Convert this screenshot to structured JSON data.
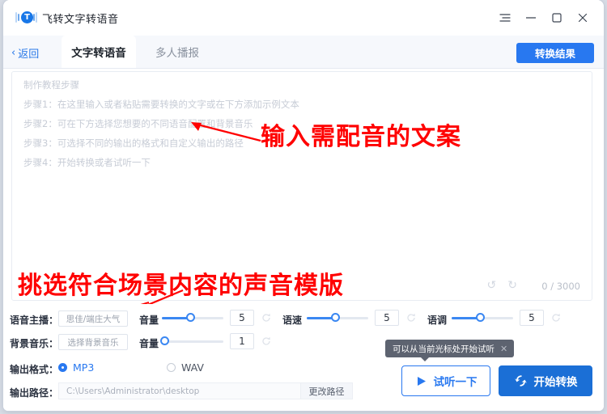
{
  "window": {
    "app_title": "飞转文字转语音",
    "logo_letter": "T",
    "controls": {
      "menu": "menu-icon",
      "minimize": "minimize-icon",
      "maximize": "maximize-icon",
      "close": "close-icon"
    }
  },
  "tabbar": {
    "back_label": "返回",
    "back_chevron": "‹",
    "tabs": [
      {
        "label": "文字转语音",
        "active": true
      },
      {
        "label": "多人播报",
        "active": false
      }
    ],
    "convert_result_label": "转换结果"
  },
  "editor": {
    "placeholder_title": "制作教程步骤",
    "placeholder_lines": [
      "步骤1：在这里输入或者粘贴需要转换的文字或在下方添加示例文本",
      "步骤2：可在下方选择您想要的不同语音配置和背景音乐",
      "步骤3：可选择不同的输出的格式和自定义输出的路径",
      "步骤4：开始转换或者试听一下"
    ],
    "undo_icon": "↺",
    "redo_icon": "↻",
    "char_count": "0 / 3000"
  },
  "annotations": [
    {
      "text": "输入需配音的文案",
      "color": "#ff0000"
    },
    {
      "text": "挑选符合场景内容的声音模版",
      "color": "#ff0000"
    }
  ],
  "settings": {
    "voice_row": {
      "label": "语音主播：",
      "selected_voice": "思佳/端庄大气",
      "volume_label": "音量",
      "volume_value": "5",
      "speed_label": "语速",
      "speed_value": "5",
      "pitch_label": "语调",
      "pitch_value": "5"
    },
    "bgm_row": {
      "label": "背景音乐：",
      "select_bgm": "选择背景音乐",
      "volume_label": "音量",
      "volume_value": "1"
    },
    "format_row": {
      "label": "输出格式：",
      "options": [
        {
          "label": "MP3",
          "selected": true
        },
        {
          "label": "WAV",
          "selected": false
        }
      ]
    },
    "path_row": {
      "label": "输出路径：",
      "path_value": "C:\\Users\\Administrator\\desktop",
      "change_button": "更改路径"
    }
  },
  "tooltip": {
    "text": "可以从当前光标处开始试听",
    "close_icon": "✕"
  },
  "actions": {
    "preview_label": "试听一下",
    "preview_icon": "play-icon",
    "start_label": "开始转换",
    "start_icon": "lightning-icon"
  },
  "colors": {
    "accent_blue": "#2878f0",
    "start_blue": "#1b6fd6",
    "annotation_red": "#ff0000",
    "tooltip_gray": "#5d6370"
  }
}
